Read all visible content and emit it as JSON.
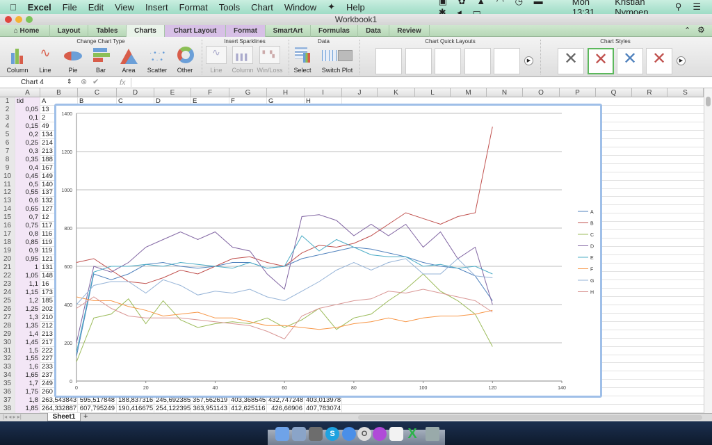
{
  "menubar": {
    "app": "Excel",
    "items": [
      "File",
      "Edit",
      "View",
      "Insert",
      "Format",
      "Tools",
      "Chart",
      "Window",
      "Help"
    ],
    "clock": "Mon 13:31",
    "user": "Kristian Nymoen"
  },
  "window": {
    "title": "Workbook1"
  },
  "tabs": [
    "Home",
    "Layout",
    "Tables",
    "Charts",
    "Chart Layout",
    "Format",
    "SmartArt",
    "Formulas",
    "Data",
    "Review"
  ],
  "ribbon": {
    "groups": {
      "change_type": "Change Chart Type",
      "sparklines": "Insert Sparklines",
      "data": "Data",
      "quick_layouts": "Chart Quick Layouts",
      "styles": "Chart Styles"
    },
    "chart_types": [
      "Column",
      "Line",
      "Pie",
      "Bar",
      "Area",
      "Scatter",
      "Other"
    ],
    "sparklines": [
      "Line",
      "Column",
      "Win/Loss"
    ],
    "data_buttons": [
      "Select",
      "Switch Plot"
    ]
  },
  "formula_bar": {
    "name_box": "Chart 4",
    "fx": "fx",
    "value": ""
  },
  "columns": [
    "A",
    "B",
    "C",
    "D",
    "E",
    "F",
    "G",
    "H",
    "I",
    "J",
    "K",
    "L",
    "M",
    "N",
    "O",
    "P",
    "Q",
    "R",
    "S"
  ],
  "sheet": {
    "header_row": [
      "tid",
      "A",
      "B",
      "C",
      "D",
      "E",
      "F",
      "G",
      "H"
    ],
    "rows_partial": [
      [
        "0,05",
        "13"
      ],
      [
        "0,1",
        "2"
      ],
      [
        "0,15",
        "49"
      ],
      [
        "0,2",
        "134"
      ],
      [
        "0,25",
        "214"
      ],
      [
        "0,3",
        "213"
      ],
      [
        "0,35",
        "188"
      ],
      [
        "0,4",
        "167"
      ],
      [
        "0,45",
        "149"
      ],
      [
        "0,5",
        "140"
      ],
      [
        "0,55",
        "137"
      ],
      [
        "0,6",
        "132"
      ],
      [
        "0,65",
        "127"
      ],
      [
        "0,7",
        "12"
      ],
      [
        "0,75",
        "117"
      ],
      [
        "0,8",
        "116"
      ],
      [
        "0,85",
        "119"
      ],
      [
        "0,9",
        "119"
      ],
      [
        "0,95",
        "121"
      ],
      [
        "1",
        "131"
      ],
      [
        "1,05",
        "148"
      ],
      [
        "1,1",
        "16"
      ],
      [
        "1,15",
        "173"
      ],
      [
        "1,2",
        "185"
      ],
      [
        "1,25",
        "202"
      ],
      [
        "1,3",
        "210"
      ],
      [
        "1,35",
        "212"
      ],
      [
        "1,4",
        "213"
      ],
      [
        "1,45",
        "217"
      ],
      [
        "1,5",
        "222"
      ],
      [
        "1,55",
        "227"
      ],
      [
        "1,6",
        "233"
      ],
      [
        "1,65",
        "237"
      ],
      [
        "1,7",
        "249"
      ],
      [
        "1,75",
        "260"
      ]
    ],
    "rows_full": [
      [
        "1,8",
        "263,543843",
        "595,517848",
        "188,837316",
        "245,692385",
        "357,562619",
        "403,368545",
        "432,747248",
        "403,013978"
      ],
      [
        "1,85",
        "264,332887",
        "607,795249",
        "190,416675",
        "254,122395",
        "363,951143",
        "412,625116",
        "426,66906",
        "407,783074"
      ]
    ],
    "tab": "Sheet1",
    "add_tab": "+"
  },
  "chart_data": {
    "type": "line",
    "title": "",
    "xlabel": "",
    "ylabel": "",
    "xlim": [
      0,
      140
    ],
    "ylim": [
      0,
      1400
    ],
    "xticks": [
      "0",
      "20",
      "40",
      "60",
      "80",
      "100",
      "120",
      "140"
    ],
    "yticks": [
      "0",
      "200",
      "400",
      "600",
      "800",
      "1000",
      "1200",
      "1400"
    ],
    "grid": "horizontal",
    "legend": "right",
    "x": [
      0,
      5,
      10,
      15,
      20,
      25,
      30,
      35,
      40,
      45,
      50,
      55,
      60,
      65,
      70,
      75,
      80,
      85,
      90,
      95,
      100,
      105,
      110,
      115,
      120
    ],
    "series": [
      {
        "name": "A",
        "color": "#4f81bd",
        "values": [
          130,
          560,
          530,
          560,
          610,
          620,
          600,
          590,
          600,
          620,
          620,
          590,
          600,
          640,
          660,
          680,
          700,
          690,
          670,
          650,
          620,
          600,
          590,
          550,
          420
        ]
      },
      {
        "name": "B",
        "color": "#c0504d",
        "values": [
          620,
          640,
          580,
          520,
          510,
          540,
          580,
          560,
          600,
          640,
          650,
          620,
          600,
          670,
          710,
          700,
          720,
          760,
          820,
          880,
          850,
          820,
          860,
          880,
          1330
        ]
      },
      {
        "name": "C",
        "color": "#9bbb59",
        "values": [
          100,
          330,
          350,
          430,
          300,
          420,
          320,
          280,
          300,
          310,
          300,
          330,
          280,
          320,
          380,
          270,
          330,
          350,
          420,
          480,
          560,
          470,
          420,
          350,
          180
        ]
      },
      {
        "name": "D",
        "color": "#8064a2",
        "values": [
          200,
          600,
          570,
          620,
          700,
          740,
          780,
          740,
          780,
          700,
          680,
          560,
          480,
          860,
          870,
          840,
          760,
          820,
          760,
          820,
          700,
          780,
          640,
          700,
          400
        ]
      },
      {
        "name": "E",
        "color": "#4bacc6",
        "values": [
          150,
          570,
          600,
          600,
          610,
          600,
          620,
          610,
          600,
          590,
          620,
          590,
          600,
          760,
          680,
          740,
          700,
          660,
          650,
          650,
          600,
          610,
          590,
          600,
          560
        ]
      },
      {
        "name": "F",
        "color": "#f79646",
        "values": [
          440,
          420,
          420,
          390,
          370,
          340,
          350,
          360,
          330,
          330,
          310,
          290,
          290,
          280,
          270,
          280,
          300,
          310,
          330,
          310,
          330,
          340,
          340,
          350,
          370
        ]
      },
      {
        "name": "G",
        "color": "#95b3d7",
        "values": [
          400,
          500,
          520,
          520,
          460,
          530,
          500,
          450,
          470,
          460,
          480,
          440,
          420,
          470,
          520,
          580,
          620,
          580,
          620,
          640,
          560,
          560,
          640,
          550,
          540
        ]
      },
      {
        "name": "H",
        "color": "#d99694",
        "values": [
          380,
          440,
          380,
          340,
          330,
          330,
          330,
          320,
          310,
          300,
          290,
          260,
          220,
          340,
          380,
          400,
          420,
          430,
          470,
          460,
          480,
          460,
          440,
          420,
          360
        ]
      }
    ]
  }
}
